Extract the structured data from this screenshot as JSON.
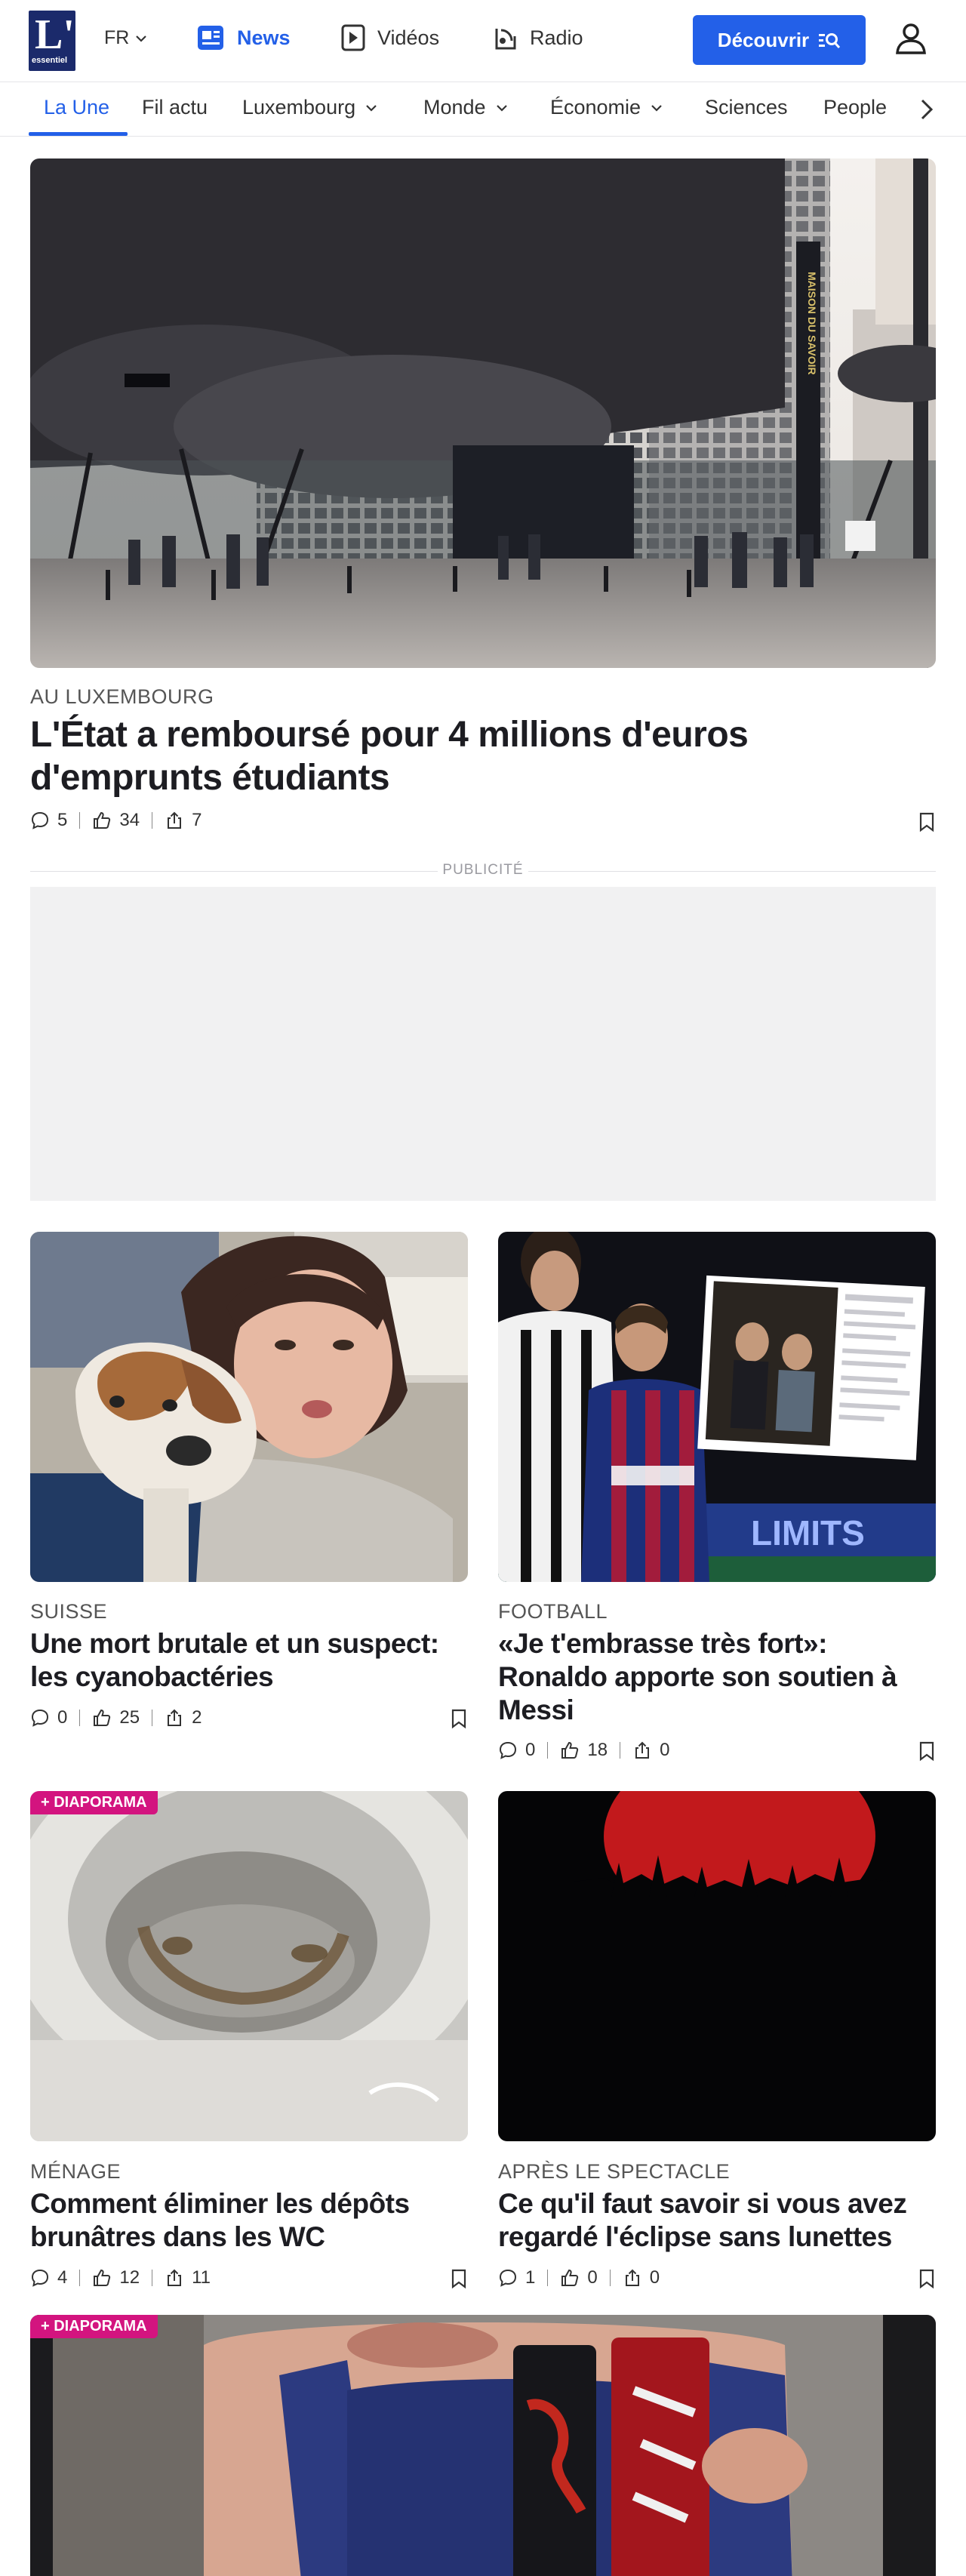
{
  "header": {
    "logo_big": "L'",
    "logo_small": "essentiel",
    "language": "FR",
    "nav": [
      {
        "label": "News",
        "icon": "newspaper-icon",
        "active": true
      },
      {
        "label": "Vidéos",
        "icon": "play-icon",
        "active": false
      },
      {
        "label": "Radio",
        "icon": "radio-icon",
        "active": false
      }
    ],
    "discover_label": "Découvrir",
    "colors": {
      "accent": "#2360e8",
      "logo": "#1b2a6b",
      "badge": "#d3147f"
    }
  },
  "tabs": [
    {
      "label": "La Une",
      "active": true,
      "dropdown": false
    },
    {
      "label": "Fil actu",
      "active": false,
      "dropdown": false
    },
    {
      "label": "Luxembourg",
      "active": false,
      "dropdown": true
    },
    {
      "label": "Monde",
      "active": false,
      "dropdown": true
    },
    {
      "label": "Économie",
      "active": false,
      "dropdown": true
    },
    {
      "label": "Sciences",
      "active": false,
      "dropdown": false
    },
    {
      "label": "People",
      "active": false,
      "dropdown": false
    }
  ],
  "hero": {
    "kicker": "AU LUXEMBOURG",
    "title": "L'État a remboursé pour 4 millions d'euros d'emprunts étudiants",
    "comments": "5",
    "likes": "34",
    "shares": "7",
    "sign_text": "MAISON DU SAVOIR"
  },
  "ad": {
    "label": "PUBLICITÉ"
  },
  "articles": [
    {
      "kicker": "SUISSE",
      "title": "Une mort brutale et un suspect: les cyanobactéries",
      "comments": "0",
      "likes": "25",
      "shares": "2"
    },
    {
      "kicker": "FOOTBALL",
      "title": "«Je t'embrasse très fort»: Ronaldo apporte son soutien à Messi",
      "comments": "0",
      "likes": "18",
      "shares": "0",
      "image_text": "LIMITS"
    },
    {
      "kicker": "MÉNAGE",
      "title": "Comment éliminer les dépôts brunâtres dans les WC",
      "comments": "4",
      "likes": "12",
      "shares": "11",
      "badge": "+ DIAPORAMA"
    },
    {
      "kicker": "APRÈS LE SPECTACLE",
      "title": "Ce qu'il faut savoir si vous avez regardé l'éclipse sans lunettes",
      "comments": "1",
      "likes": "0",
      "shares": "0"
    }
  ],
  "bottom": {
    "badge": "+ DIAPORAMA"
  }
}
